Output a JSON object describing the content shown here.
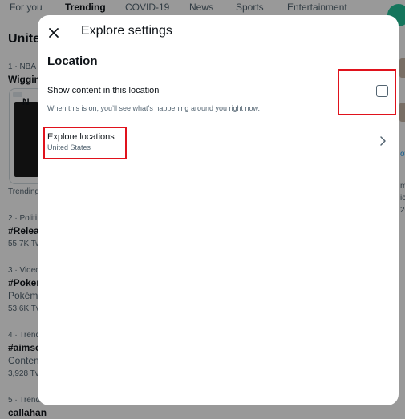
{
  "tabs": [
    "For you",
    "Trending",
    "COVID-19",
    "News",
    "Sports",
    "Entertainment"
  ],
  "active_tab": "Trending",
  "background": {
    "title": "Unite",
    "trends": [
      {
        "meta": "1 · NBA",
        "name": "Wiggin",
        "footer": "Trending"
      },
      {
        "meta": "2 · Politi",
        "name": "#Relea",
        "count": "55.7K Tw"
      },
      {
        "meta": "3 · Video",
        "name": "#Poker",
        "sub": "Pokémo",
        "count": "53.6K Tv"
      },
      {
        "meta": "4 · Trend",
        "name": "#aimse",
        "sub": "Conten",
        "count": "3,928 Tv"
      },
      {
        "meta": "5 · Trend",
        "name": "callahan"
      }
    ],
    "news_label": "N",
    "right_link": "ov",
    "right_texts": [
      "ma",
      "ic",
      "20"
    ]
  },
  "modal": {
    "title": "Explore settings",
    "section_title": "Location",
    "show_content": {
      "label": "Show content in this location",
      "description": "When this is on, you’ll see what’s happening around you right now.",
      "checked": false
    },
    "explore_locations": {
      "label": "Explore locations",
      "value": "United States"
    }
  },
  "icons": {
    "close": "close-icon",
    "chevron": "chevron-right-icon"
  },
  "colors": {
    "highlight": "#e0121c",
    "overlay": "rgba(0,0,0,0.4)",
    "accent": "#1d9bf0"
  }
}
